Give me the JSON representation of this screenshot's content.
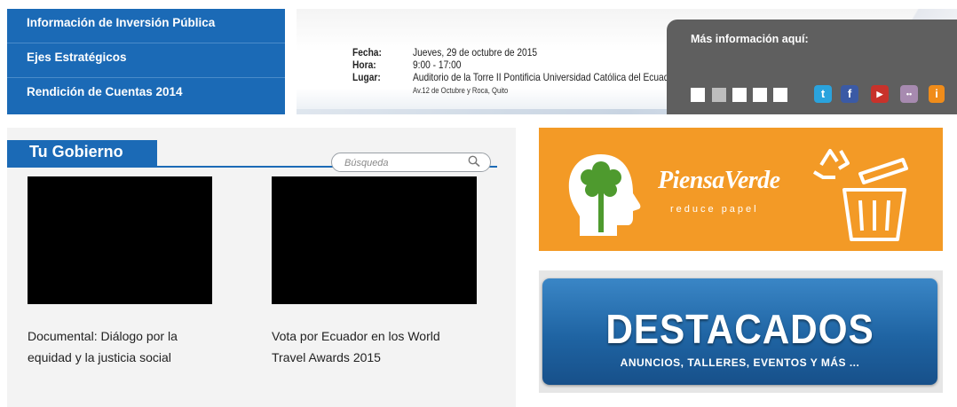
{
  "nav": {
    "items": [
      {
        "label": "Información de Inversión Pública"
      },
      {
        "label": "Ejes Estratégicos"
      },
      {
        "label": "Rendición de Cuentas 2014"
      }
    ]
  },
  "event": {
    "fecha_label": "Fecha:",
    "fecha_value": "Jueves, 29 de octubre de 2015",
    "hora_label": "Hora:",
    "hora_value": "9:00 - 17:00",
    "lugar_label": "Lugar:",
    "lugar_value": "Auditorio de la Torre II Pontificia Universidad Católica del Ecuador",
    "address": "Av.12 de Octubre y Roca, Quito"
  },
  "info": {
    "title": "Más información aquí:",
    "social": [
      {
        "icon": "twitter-icon",
        "glyph": "t",
        "color": "#2aa3dd"
      },
      {
        "icon": "facebook-icon",
        "glyph": "f",
        "color": "#3b5aa5"
      },
      {
        "icon": "youtube-icon",
        "glyph": "▶",
        "color": "#c8322b"
      },
      {
        "icon": "flickr-icon",
        "glyph": "••",
        "color": "#a78ab0"
      },
      {
        "icon": "info-icon",
        "glyph": "i",
        "color": "#f08c1a"
      }
    ]
  },
  "gobierno": {
    "tab_label": "Tu Gobierno",
    "search_placeholder": "Búsqueda",
    "videos": [
      {
        "caption": "Documental: Diálogo por la equidad y la justicia social"
      },
      {
        "caption": "Vota por Ecuador en los World Travel Awards 2015"
      }
    ]
  },
  "banners": {
    "green_brand": "PiensaVerde",
    "green_sub": "reduce papel",
    "dest_title": "DESTACADOS",
    "dest_sub": "ANUNCIOS, TALLERES, EVENTOS  Y MÁS ..."
  },
  "colors": {
    "nav_blue": "#1b6ab6",
    "orange": "#f39a26",
    "info_gray": "#5f5f5f"
  }
}
